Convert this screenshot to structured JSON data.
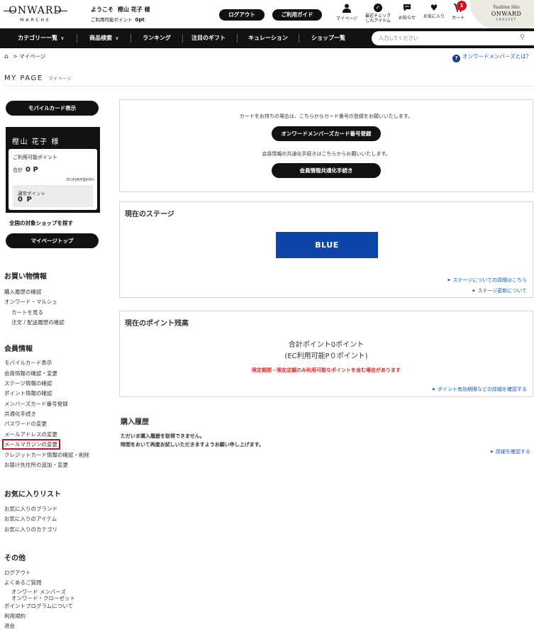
{
  "header": {
    "logo": "ONWARD",
    "logo_sub": "MARCHE",
    "welcome_prefix": "ようこそ",
    "user_name": "樫山 花子 様",
    "points_label": "ご利用可能ポイント",
    "points_value": "0pt",
    "logout": "ログアウト",
    "guide": "ご利用ガイド",
    "icons": {
      "mypage": "マイページ",
      "recent_1": "最近チェック",
      "recent_2": "したアイテム",
      "notice": "お知らせ",
      "favorite": "お気に入り",
      "cart": "カート"
    },
    "cart_count": "1",
    "fashion_site": "Fashion Site",
    "fashion_logo": "ONWARD",
    "fashion_sub": "CROSSET"
  },
  "nav": {
    "items": [
      "カテゴリー一覧",
      "商品検索",
      "ランキング",
      "注目のギフト",
      "キュレーション",
      "ショップ一覧"
    ],
    "search_placeholder": "入力してください"
  },
  "breadcrumb": {
    "home": "⌂",
    "sep": ">",
    "current": "マイページ"
  },
  "member_link": "オンワードメンバーズとは？",
  "page_title": "MY PAGE",
  "page_title_sub": "マイページ",
  "sidebar": {
    "mobile_card_btn": "モバイルカード表示",
    "card_name": "樫山 花子 様",
    "available_label": "ご利用可能ポイント",
    "total_label": "合計",
    "total_value": "0 P",
    "ec_note": "(EC利用可能P0P)",
    "normal_label": "通常ポイント",
    "normal_value": "0 P",
    "find_shop": "全国の対象ショップを探す",
    "mypage_top_btn": "マイページトップ",
    "sections": {
      "shopping": {
        "title": "お買い物情報",
        "items": [
          "購入履歴の確認",
          "オンワード・マルシェ",
          "カートを見る",
          "注文 / 配送履歴の確認"
        ]
      },
      "member": {
        "title": "会員情報",
        "items": [
          "モバイルカード表示",
          "会員情報の確認・変更",
          "ステージ情報の確認",
          "ポイント情報の確認",
          "メンバーズカード番号登録",
          "共通化手続き",
          "パスワードの変更",
          "メールアドレスの変更",
          "メールマガジンの変更",
          "クレジットカード情報の確認・削除",
          "お届け先住所の追加・変更"
        ]
      },
      "favorites": {
        "title": "お気に入りリスト",
        "items": [
          "お気に入りのブランド",
          "お気に入りのアイテム",
          "お気に入りのカテゴリ"
        ]
      },
      "other": {
        "title": "その他",
        "items": [
          "ログアウト",
          "よくあるご質問",
          "オンワード メンバーズ",
          "オンワード・クローゼット",
          "ポイントプログラムについて",
          "利用規約",
          "退会"
        ]
      }
    }
  },
  "main": {
    "card_panel": {
      "text1": "カードをお持ちの場合は、こちらからカード番号の登録をお願いいたします。",
      "btn1": "オンワードメンバーズカード番号登録",
      "text2": "会員情報の共通化手続きはこちらからお願いいたします。",
      "btn2": "会員情報共通化手続き"
    },
    "stage_panel": {
      "title": "現在のステージ",
      "stage": "BLUE",
      "link1": "ステージについての詳細はこちら",
      "link2": "ステージ更新について"
    },
    "points_panel": {
      "title": "現在のポイント残高",
      "total": "合計ポイント0ポイント",
      "ec": "(EC利用可能P０ポイント)",
      "note": "限定期間・限定店舗のみ利用可能なポイントを含む場合があります",
      "link": "ポイント有効期限などの詳細を確認する"
    },
    "history": {
      "title": "購入履歴",
      "line1": "ただいま購入履歴を取得できません。",
      "line2": "時間をおいて再度お試しいただきますようお願い申し上げます。",
      "link": "詳細を確認する"
    }
  },
  "colors": {
    "brand_black": "#111111",
    "stage_blue": "#0d46a8",
    "link_blue": "#1a5aa8",
    "alert_red": "#d42a2a",
    "badge_red": "#d40f1f"
  }
}
